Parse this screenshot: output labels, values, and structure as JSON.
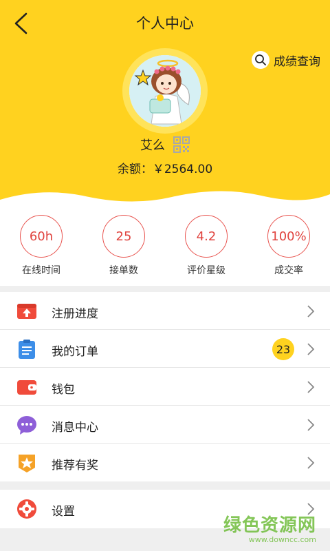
{
  "header": {
    "title": "个人中心",
    "query_label": "成绩查询"
  },
  "profile": {
    "name": "艾么",
    "balance": "余额：￥2564.00"
  },
  "stats": [
    {
      "value": "60h",
      "label": "在线时间"
    },
    {
      "value": "25",
      "label": "接单数"
    },
    {
      "value": "4.2",
      "label": "评价星级"
    },
    {
      "value": "100%",
      "label": "成交率"
    }
  ],
  "menu": {
    "items": [
      {
        "label": "注册进度",
        "icon": "upload-box-icon"
      },
      {
        "label": "我的订单",
        "icon": "clipboard-icon",
        "badge": "23"
      },
      {
        "label": "钱包",
        "icon": "wallet-icon"
      },
      {
        "label": "消息中心",
        "icon": "chat-bubble-icon"
      },
      {
        "label": "推荐有奖",
        "icon": "star-badge-icon"
      }
    ],
    "settings": {
      "label": "设置",
      "icon": "gear-icon"
    }
  },
  "watermark": {
    "text": "绿色资源网",
    "url": "www.downcc.com"
  },
  "colors": {
    "accent": "#ffd21f",
    "stat_ring": "#e8524d",
    "icon_red": "#f04b3b",
    "icon_blue": "#3d8ee8",
    "icon_purple": "#8e5fd8",
    "icon_orange": "#f5a227"
  }
}
